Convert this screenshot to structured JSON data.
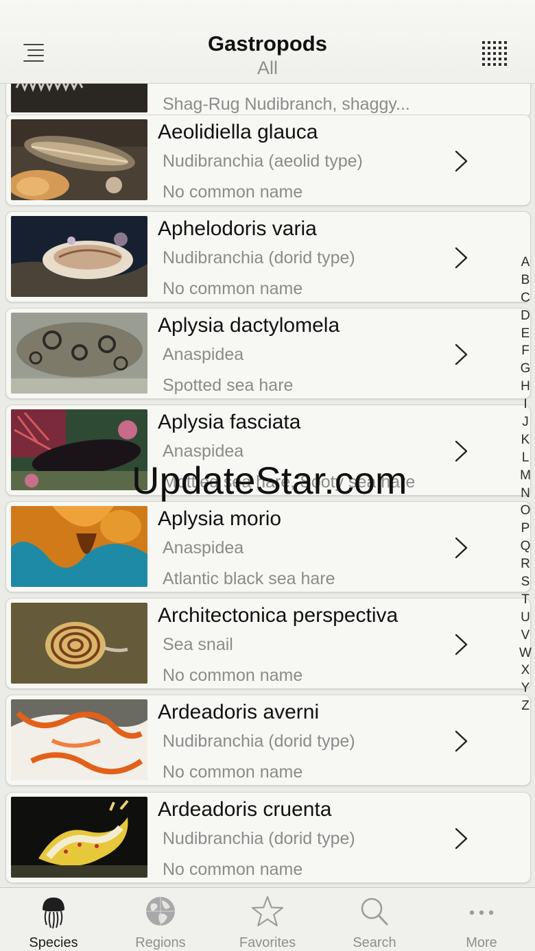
{
  "header": {
    "title": "Gastropods",
    "subtitle": "All"
  },
  "list": {
    "partial_item": {
      "common": "Shag-Rug Nudibranch, shaggy..."
    },
    "items": [
      {
        "name": "Aeolidiella glauca",
        "group": "Nudibranchia (aeolid type)",
        "common": "No common name",
        "thumb": "aeolid-nudibranch-photo"
      },
      {
        "name": "Aphelodoris varia",
        "group": "Nudibranchia (dorid type)",
        "common": "No common name",
        "thumb": "dorid-nudibranch-photo"
      },
      {
        "name": "Aplysia dactylomela",
        "group": "Anaspidea",
        "common": "Spotted sea hare",
        "thumb": "spotted-sea-hare-photo"
      },
      {
        "name": "Aplysia fasciata",
        "group": "Anaspidea",
        "common": "Mottled sea hare, Sooty sea hare",
        "thumb": "sooty-sea-hare-photo"
      },
      {
        "name": "Aplysia morio",
        "group": "Anaspidea",
        "common": "Atlantic black sea hare",
        "thumb": "black-sea-hare-photo"
      },
      {
        "name": "Architectonica perspectiva",
        "group": "Sea snail",
        "common": "No common name",
        "thumb": "sea-snail-photo"
      },
      {
        "name": "Ardeadoris averni",
        "group": "Nudibranchia (dorid type)",
        "common": "No common name",
        "thumb": "white-orange-nudibranch-photo"
      },
      {
        "name": "Ardeadoris cruenta",
        "group": "Nudibranchia (dorid type)",
        "common": "No common name",
        "thumb": "yellow-nudibranch-photo"
      }
    ]
  },
  "index_letters": [
    "A",
    "B",
    "C",
    "D",
    "E",
    "F",
    "G",
    "H",
    "I",
    "J",
    "K",
    "L",
    "M",
    "N",
    "O",
    "P",
    "Q",
    "R",
    "S",
    "T",
    "U",
    "V",
    "W",
    "X",
    "Y",
    "Z"
  ],
  "watermark": "UpdateStar.com",
  "tabs": [
    {
      "label": "Species",
      "icon": "jellyfish-icon",
      "active": true
    },
    {
      "label": "Regions",
      "icon": "globe-icon",
      "active": false
    },
    {
      "label": "Favorites",
      "icon": "star-icon",
      "active": false
    },
    {
      "label": "Search",
      "icon": "magnifier-icon",
      "active": false
    },
    {
      "label": "More",
      "icon": "more-dots-icon",
      "active": false
    }
  ],
  "colors": {
    "background": "#ebebe8",
    "card": "#f7f7f4",
    "secondary_text": "#8b8b8b",
    "active_tab": "#1c1c1c",
    "inactive_tab": "#8f8f8f"
  }
}
